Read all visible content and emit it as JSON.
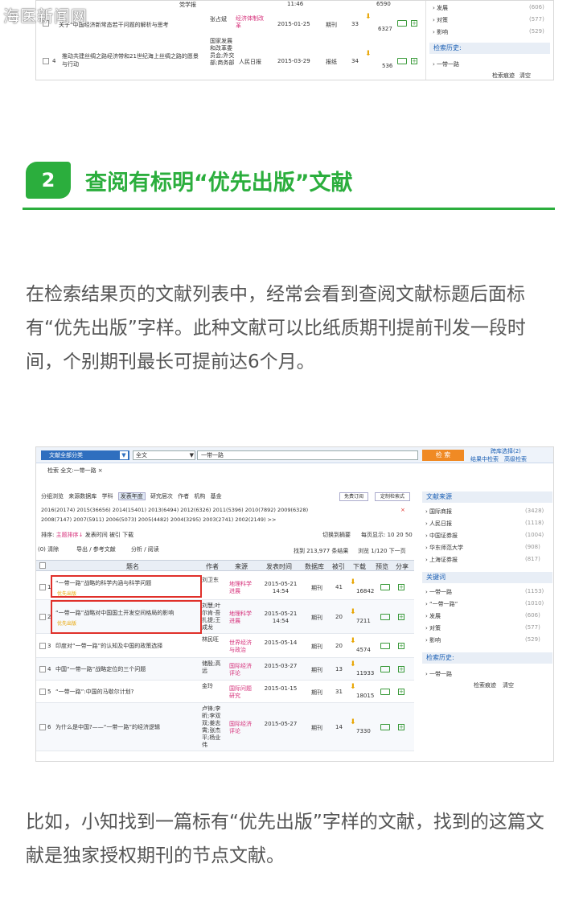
{
  "watermark": "海医新闻网",
  "shot1": {
    "rows": [
      {
        "title": "关于“中国经济新常态若干问题的解析与思考",
        "author": "张占斌",
        "source": "经济体制改革",
        "date": "2015-01-25",
        "db": "期刊",
        "cites": "33",
        "downloads": "6327",
        "extra_top": "党学报",
        "time_top": "11:46",
        "dl_top": "6590"
      },
      {
        "num": "4",
        "title": "推动共建丝绸之路经济带和21世纪海上丝绸之路的愿景与行动",
        "author": "国家发展和改革委员会;外交部;商务部",
        "source": "人民日报",
        "date": "2015-03-29",
        "db": "报纸",
        "cites": "34",
        "downloads": "536"
      }
    ],
    "side": {
      "items": [
        {
          "label": "发展",
          "count": "(606)"
        },
        {
          "label": "对策",
          "count": "(577)"
        },
        {
          "label": "影响",
          "count": "(529)"
        }
      ],
      "history_title": "检索历史:",
      "history_item": "一带一路",
      "history_trace": "检索痕迹",
      "history_clear": "清空"
    }
  },
  "section": {
    "number": "2",
    "title": "查阅有标明“优先出版”文献"
  },
  "para1": "在检索结果页的文献列表中，经常会看到查阅文献标题后面标有“优先出版”字样。此种文献可以比纸质期刊提前刊发一段时间，个别期刊最长可提前达6个月。",
  "shot2": {
    "top_link": "跨库选择(2)",
    "category_label": "文献全部分类",
    "field_select": "全文",
    "query": "一带一路",
    "search_button": "检 索",
    "result_search": "结果中检索",
    "advanced_search": "高级检索",
    "breadcrumb": "检索 全文:一带一路 ×",
    "group_tabs": [
      "分组浏览",
      "来源数据库",
      "学科",
      "发表年度",
      "研究层次",
      "作者",
      "机构",
      "基金"
    ],
    "free_subscribe": "免费订阅",
    "custom_search": "定制检索式",
    "years_row1": "2016(20174)  2015(36656)  2014(15401)  2013(6494)  2012(6326)  2011(5396)  2010(7892)  2009(6328)",
    "years_row2": "2008(7147)   2007(5911)   2006(5073)  2005(4482)  2004(3295)  2003(2741)  2002(2149)  >>",
    "sort_label": "排序:",
    "sort_options": [
      "主题排序↓",
      "发表时间",
      "被引",
      "下载"
    ],
    "switch_abstract": "切换到摘要",
    "per_page": "每页显示: 10 20 50",
    "toolbar": [
      "(0) 清除",
      "导出 / 参考文献",
      "分析 / 阅读"
    ],
    "result_count": "找到 213,977 条结果",
    "page_info": "浏览 1/120  下一页",
    "headers": [
      "题名",
      "作者",
      "来源",
      "发表时间",
      "数据库",
      "被引",
      "下载",
      "预览",
      "分享"
    ],
    "rows": [
      {
        "num": "1",
        "title": "“一带一路”战略的科学内涵与科学问题",
        "tag": "优先出版",
        "author": "刘卫东",
        "source": "地理科学进展",
        "date": "2015-05-21 14:54",
        "db": "期刊",
        "cites": "41",
        "downloads": "16842"
      },
      {
        "num": "2",
        "title": "“一带一路”战略对中国国土开发空间格局的影响",
        "tag": "优先出版",
        "author": "刘慧;叶尔肯·吾扎提;王成龙",
        "source": "地理科学进展",
        "date": "2015-05-21 14:54",
        "db": "期刊",
        "cites": "20",
        "downloads": "7211"
      },
      {
        "num": "3",
        "title": "印度对“一带一路”的认知及中国的政策选择",
        "tag": "",
        "author": "林民旺",
        "source": "世界经济与政治",
        "date": "2015-05-14",
        "db": "期刊",
        "cites": "20",
        "downloads": "4574"
      },
      {
        "num": "4",
        "title": "中国“一带一路”战略定位的三个问题",
        "tag": "",
        "author": "储殷;高远",
        "source": "国际经济评论",
        "date": "2015-03-27",
        "db": "期刊",
        "cites": "13",
        "downloads": "11933"
      },
      {
        "num": "5",
        "title": "“一带一路”:中国的马歇尔计划?",
        "tag": "",
        "author": "金玲",
        "source": "国际问题研究",
        "date": "2015-01-15",
        "db": "期刊",
        "cites": "31",
        "downloads": "18015"
      },
      {
        "num": "6",
        "title": "为什么是中国?——“一带一路”的经济逻辑",
        "tag": "",
        "author": "卢锋;李昕;李双双;姜志霄;张杰平;杨业伟",
        "source": "国际经济评论",
        "date": "2015-05-27",
        "db": "期刊",
        "cites": "14",
        "downloads": "7330"
      }
    ],
    "side": {
      "source_title": "文献来源",
      "sources": [
        {
          "label": "国际商报",
          "count": "(3428)"
        },
        {
          "label": "人民日报",
          "count": "(1118)"
        },
        {
          "label": "中国证券报",
          "count": "(1004)"
        },
        {
          "label": "华东师范大学",
          "count": "(908)"
        },
        {
          "label": "上海证券报",
          "count": "(817)"
        }
      ],
      "keyword_title": "关键词",
      "keywords": [
        {
          "label": "一带一路",
          "count": "(1153)"
        },
        {
          "label": "“一带一路”",
          "count": "(1010)"
        },
        {
          "label": "发展",
          "count": "(606)"
        },
        {
          "label": "对策",
          "count": "(577)"
        },
        {
          "label": "影响",
          "count": "(529)"
        }
      ],
      "history_title": "检索历史:",
      "history_item": "一带一路",
      "history_trace": "检索痕迹",
      "history_clear": "清空"
    }
  },
  "para2": "比如，小知找到一篇标有“优先出版”字样的文献，找到的这篇文献是独家授权期刊的节点文献。"
}
